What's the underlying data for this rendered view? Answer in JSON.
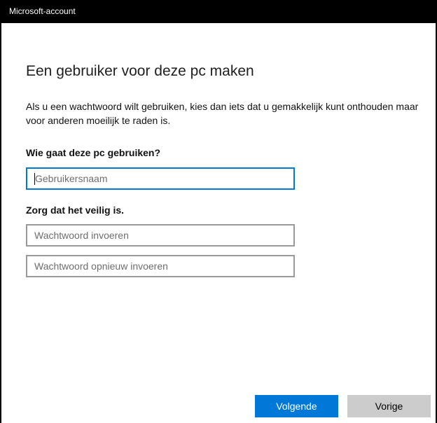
{
  "window": {
    "title": "Microsoft-account"
  },
  "page": {
    "heading": "Een gebruiker voor deze pc maken",
    "description": "Als u een wachtwoord wilt gebruiken, kies dan iets dat u gemakkelijk kunt onthouden maar voor anderen moeilijk te raden is."
  },
  "who_section": {
    "label": "Wie gaat deze pc gebruiken?",
    "username": {
      "value": "",
      "placeholder": "Gebruikersnaam"
    }
  },
  "security_section": {
    "label": "Zorg dat het veilig is.",
    "password": {
      "value": "",
      "placeholder": "Wachtwoord invoeren"
    },
    "password_repeat": {
      "value": "",
      "placeholder": "Wachtwoord opnieuw invoeren"
    }
  },
  "buttons": {
    "next_label": "Volgende",
    "back_label": "Vorige"
  },
  "colors": {
    "accent": "#0078d7",
    "titlebar": "#000000",
    "secondary_button": "#cccccc"
  }
}
